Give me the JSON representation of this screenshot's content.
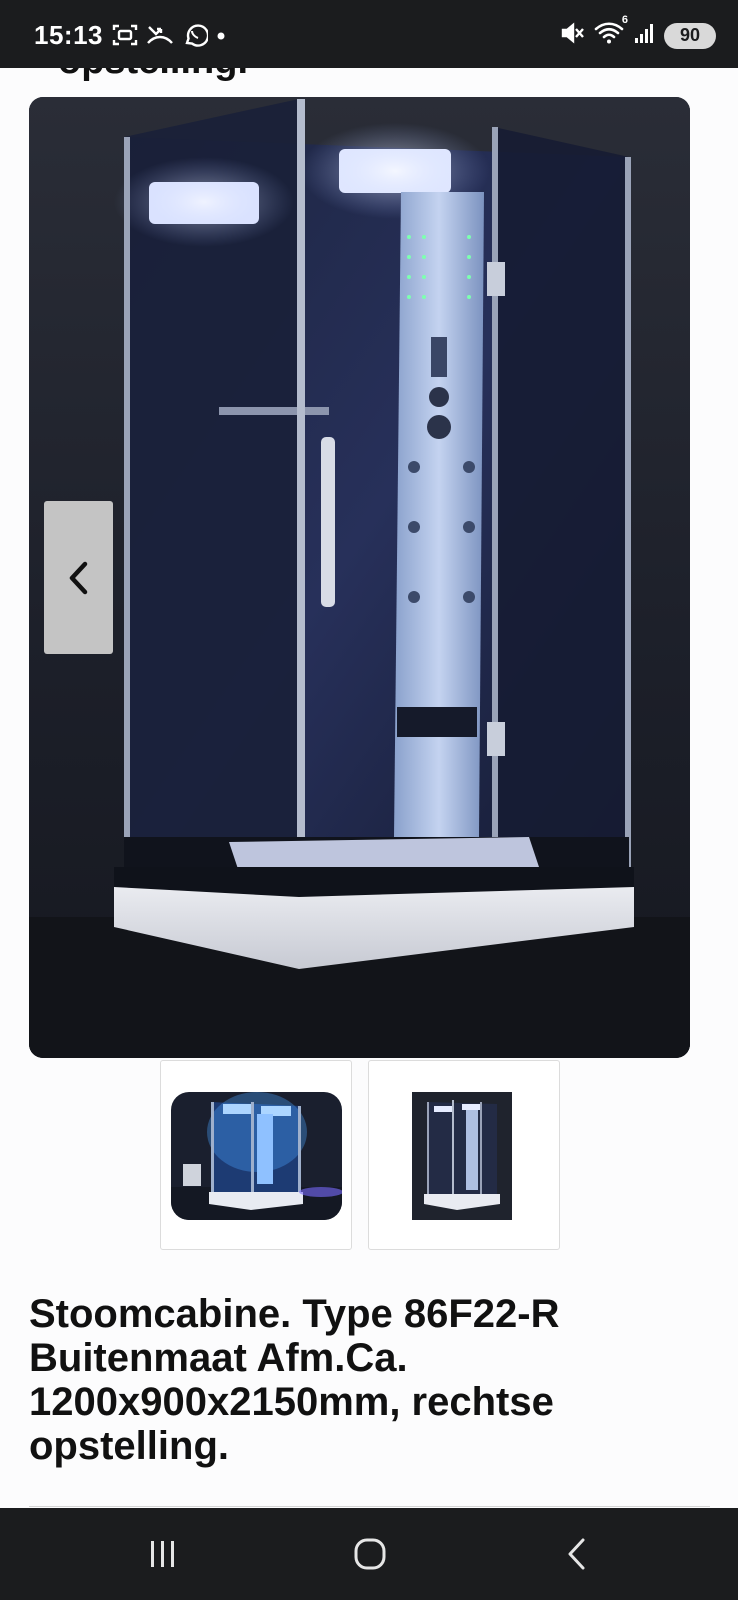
{
  "status_bar": {
    "time": "15:13",
    "left_icons": [
      "screenshot-icon",
      "missed-call-icon",
      "whatsapp-icon",
      "notification-dot-icon"
    ],
    "right_icons": [
      "mute-icon",
      "wifi-icon",
      "signal-icon"
    ],
    "wifi_label": "6",
    "battery": "90"
  },
  "page": {
    "cut_heading": "opstelling.",
    "main_image": {
      "alt_icon": "shower-cabin-photo",
      "prev_arrow": "chevron-left-icon"
    },
    "thumbnails": [
      {
        "icon": "shower-cabin-lit-photo"
      },
      {
        "icon": "shower-cabin-photo"
      }
    ],
    "product_title": "Stoomcabine. Type 86F22-R Buitenmaat Afm.Ca. 1200x900x2150mm, rechtse opstelling."
  },
  "nav_bar": {
    "recents": "recents-icon",
    "home": "home-icon",
    "back": "back-icon"
  },
  "colors": {
    "bars": "#1b1c1e",
    "background": "#fcfcfd",
    "text": "#111111",
    "arrow_bg": "#c4c4c4"
  }
}
